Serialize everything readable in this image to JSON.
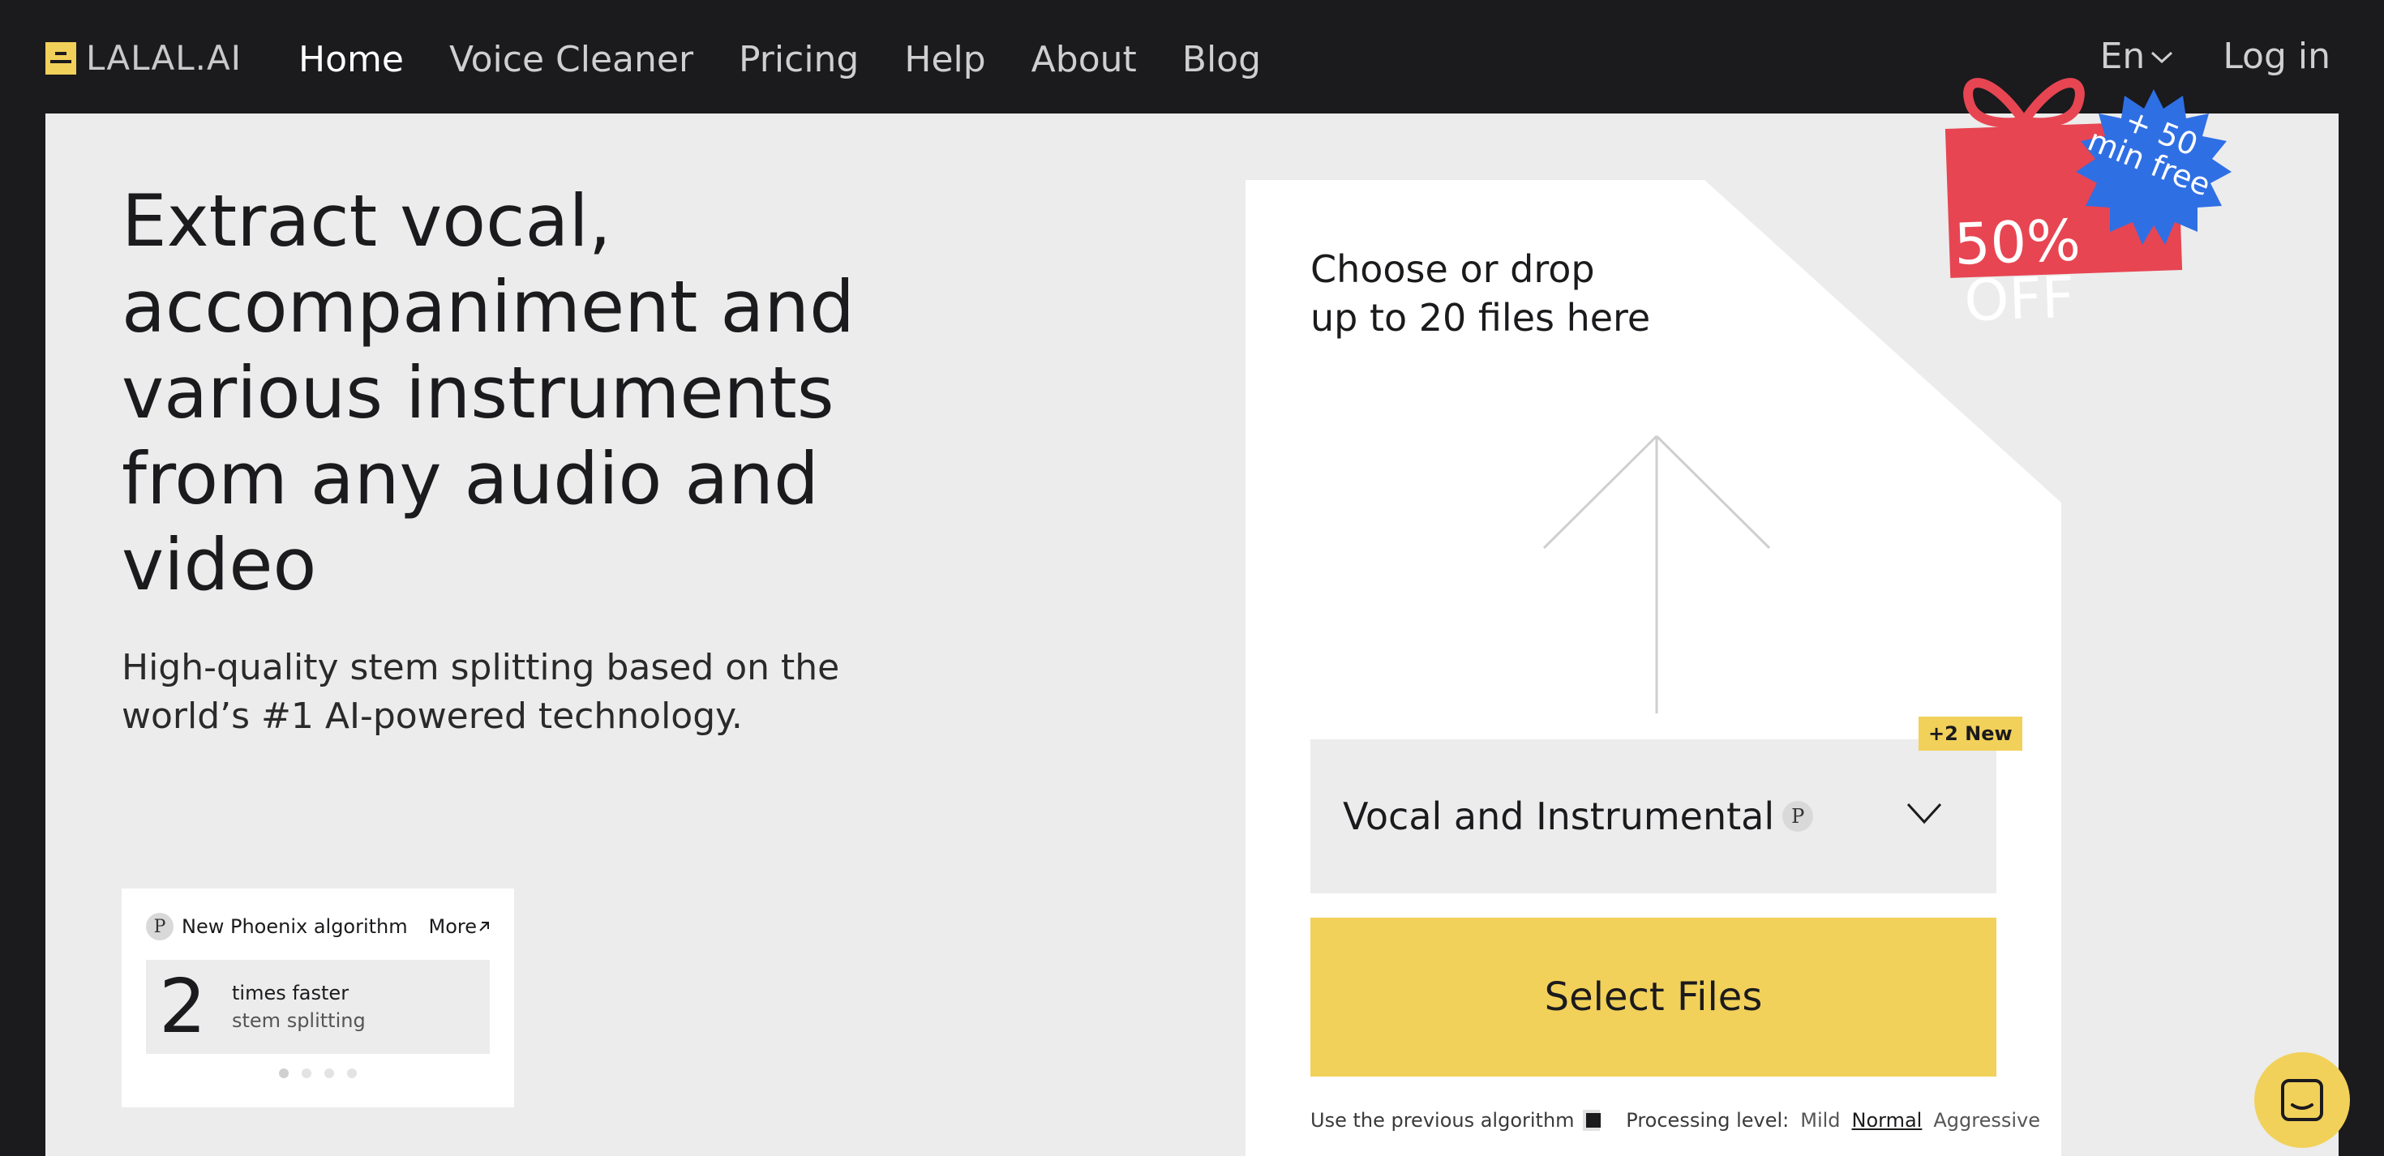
{
  "nav": {
    "logo": "LALAL.AI",
    "links": [
      "Home",
      "Voice Cleaner",
      "Pricing",
      "Help",
      "About",
      "Blog"
    ],
    "language": "En",
    "login": "Log in"
  },
  "hero": {
    "title": "Extract vocal, accompaniment and various instruments from any audio and video",
    "subtitle": "High-quality stem splitting based on the world’s #1 AI-powered technology."
  },
  "info_card": {
    "badge": "P",
    "label": "New Phoenix algorithm",
    "more": "More",
    "stat_number": "2",
    "stat_line1": "times faster",
    "stat_line2": "stem splitting"
  },
  "upload": {
    "drop_text": "Choose or drop up to 20 files here",
    "new_badge": "+2 New",
    "selected_stem": "Vocal and Instrumental",
    "stem_badge": "P",
    "select_button": "Select Files",
    "prev_algorithm": "Use the previous algorithm",
    "processing_label": "Processing level:",
    "levels": [
      "Mild",
      "Normal",
      "Aggressive"
    ],
    "active_level": "Normal"
  },
  "promo": {
    "discount": "50% OFF",
    "bonus": "+ 50 min free"
  },
  "colors": {
    "accent": "#f2d15a",
    "promo_red": "#e74552",
    "promo_blue": "#2f6fe4",
    "dark": "#1b1a1d"
  }
}
